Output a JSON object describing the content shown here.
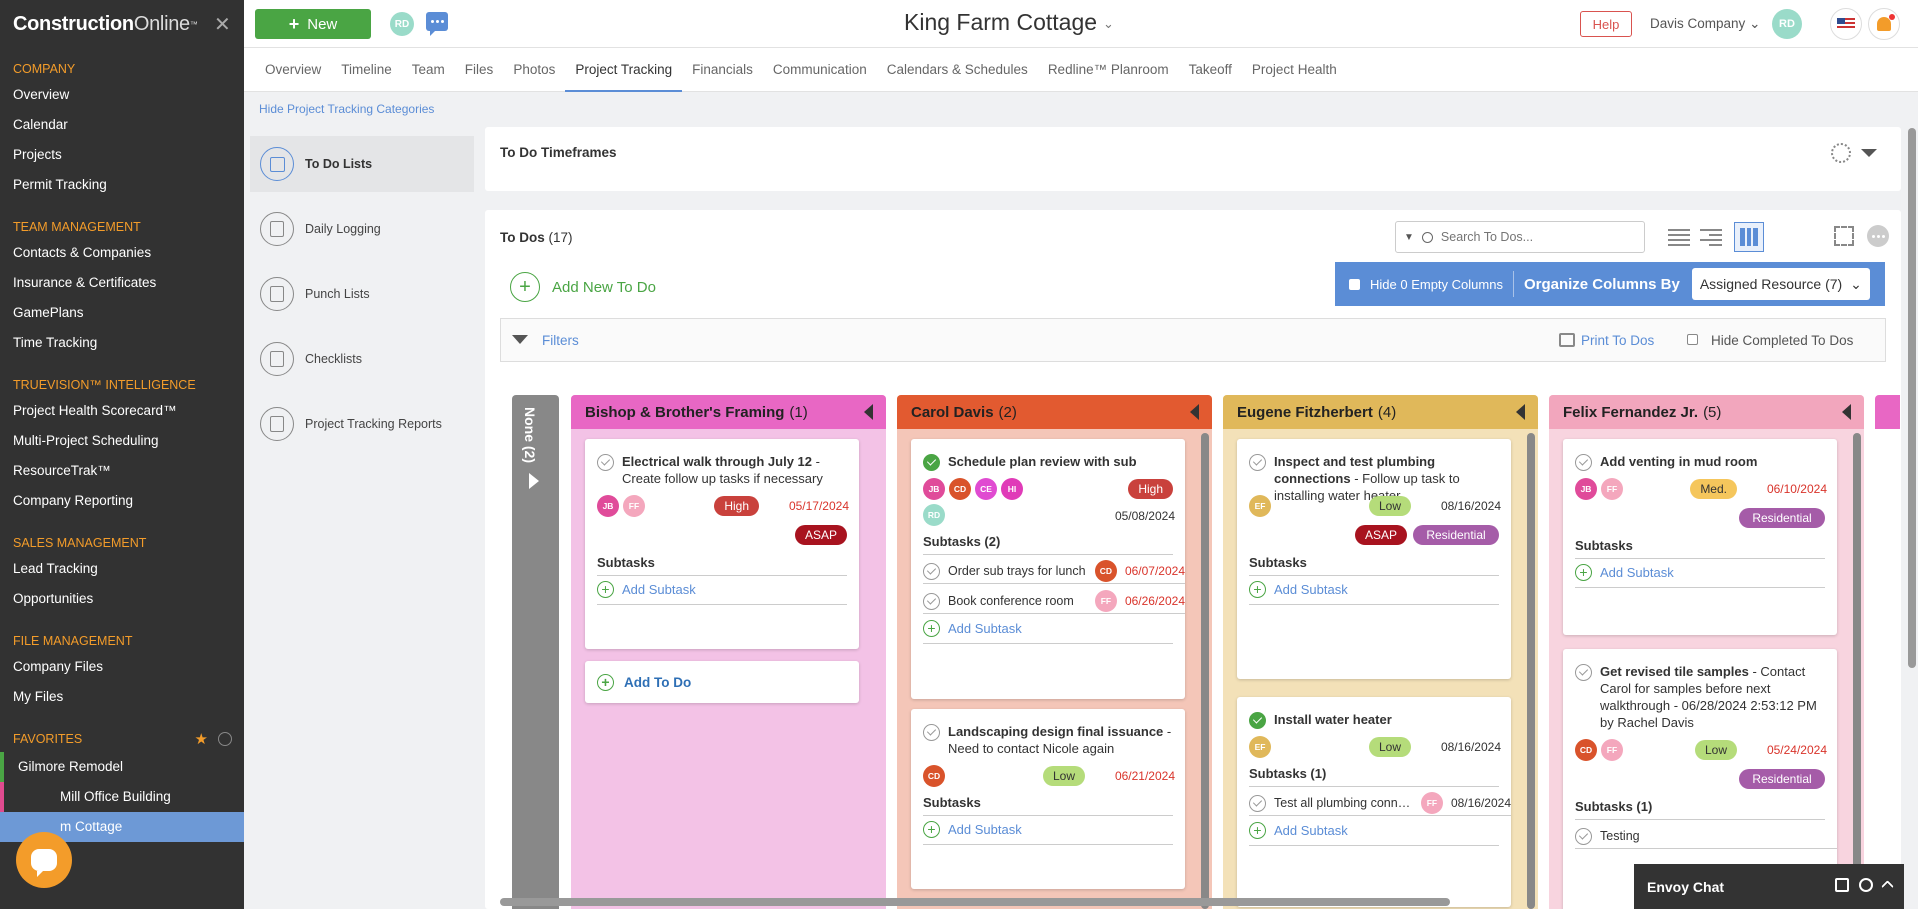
{
  "sidebar": {
    "brand": "Construction",
    "brand_suffix": "Online",
    "brand_tm": "™",
    "close": "✕",
    "sections": [
      {
        "title": "COMPANY",
        "items": [
          "Overview",
          "Calendar",
          "Projects",
          "Permit Tracking"
        ]
      },
      {
        "title": "TEAM MANAGEMENT",
        "items": [
          "Contacts & Companies",
          "Insurance & Certificates",
          "GamePlans",
          "Time Tracking"
        ]
      },
      {
        "title": "TRUEVISION™ INTELLIGENCE",
        "items": [
          "Project Health Scorecard™",
          "Multi-Project Scheduling",
          "ResourceTrak™",
          "Company Reporting"
        ]
      },
      {
        "title": "SALES MANAGEMENT",
        "items": [
          "Lead Tracking",
          "Opportunities"
        ]
      },
      {
        "title": "FILE MANAGEMENT",
        "items": [
          "Company Files",
          "My Files"
        ]
      }
    ],
    "favorites_title": "FAVORITES",
    "favorites": [
      {
        "label": "Gilmore Remodel",
        "color": "#4aa544"
      },
      {
        "label": "Mill Office Building",
        "color": "#e04b8f"
      },
      {
        "label": "m Cottage",
        "color": "#6d99d6"
      }
    ]
  },
  "topbar": {
    "new_label": "New",
    "user_initials": "RD",
    "project_title": "King Farm Cottage",
    "help_label": "Help",
    "company": "Davis Company",
    "avatar_initials": "RD"
  },
  "nav_tabs": [
    "Overview",
    "Timeline",
    "Team",
    "Files",
    "Photos",
    "Project Tracking",
    "Financials",
    "Communication",
    "Calendars & Schedules",
    "Redline™ Planroom",
    "Takeoff",
    "Project Health"
  ],
  "categories": {
    "hide_label": "Hide Project Tracking Categories",
    "items": [
      "To Do Lists",
      "Daily Logging",
      "Punch Lists",
      "Checklists",
      "Project Tracking Reports"
    ]
  },
  "timeframes": {
    "title": "To Do Timeframes"
  },
  "todos": {
    "title": "To Dos",
    "count": "(17)",
    "search_placeholder": "Search To Dos...",
    "add_label": "Add New To Do",
    "hide_empty": "Hide 0 Empty Columns",
    "organize_by": "Organize Columns By",
    "organize_value": "Assigned Resource (7)",
    "filters": "Filters",
    "print": "Print To Dos",
    "hide_completed": "Hide Completed To Dos"
  },
  "board": {
    "none_label": "None (2)",
    "columns": [
      {
        "name": "Bishop & Brother's Framing",
        "count": "(1)",
        "head_color": "#e867c4",
        "body_color": "#f3c2e6",
        "cards": [
          {
            "title": "Electrical walk through July 12",
            "desc": " - Create follow up tasks if necessary",
            "done": false,
            "avatars": [
              {
                "i": "JB",
                "c": "#e04b9a"
              },
              {
                "i": "FF",
                "c": "#f4a7bd"
              }
            ],
            "priority": "High",
            "due": "05/17/2024",
            "tag": "ASAP",
            "subtasks_label": "Subtasks",
            "subtasks": [],
            "add_subtask": "Add Subtask"
          }
        ],
        "add_todo": "Add To Do"
      },
      {
        "name": "Carol Davis",
        "count": "(2)",
        "head_color": "#e25a30",
        "body_color": "#f4c6b8",
        "cards": [
          {
            "title": "Schedule plan review with sub",
            "desc": "",
            "done": true,
            "avatars": [
              {
                "i": "JB",
                "c": "#e04b9a"
              },
              {
                "i": "CD",
                "c": "#d9532b"
              },
              {
                "i": "CE",
                "c": "#e04bd1"
              },
              {
                "i": "HI",
                "c": "#e03bb8"
              },
              {
                "i": "RD",
                "c": "#9adbc9"
              }
            ],
            "priority": "High",
            "due": "05/08/2024",
            "subtasks_label": "Subtasks (2)",
            "subtasks": [
              {
                "text": "Order sub trays for lunch",
                "av": "CD",
                "avc": "#d9532b",
                "due": "06/07/2024"
              },
              {
                "text": "Book conference room",
                "av": "FF",
                "avc": "#f4a7bd",
                "due": "06/26/2024"
              }
            ],
            "add_subtask": "Add Subtask"
          },
          {
            "title": "Landscaping design final issuance",
            "desc": " - Need to contact Nicole again",
            "done": false,
            "avatars": [
              {
                "i": "CD",
                "c": "#d9532b"
              }
            ],
            "priority": "Low",
            "due": "06/21/2024",
            "subtasks_label": "Subtasks",
            "subtasks": [],
            "add_subtask": "Add Subtask"
          }
        ]
      },
      {
        "name": "Eugene Fitzherbert",
        "count": "(4)",
        "head_color": "#e0b85a",
        "body_color": "#f3e1b8",
        "cards": [
          {
            "title": "Inspect and test plumbing connections",
            "desc": " - Follow up task to installing water heater",
            "done": false,
            "avatars": [
              {
                "i": "EF",
                "c": "#e0b85a"
              }
            ],
            "priority": "Low",
            "due": "08/16/2024",
            "tag": "ASAP",
            "tag2": "Residential",
            "subtasks_label": "Subtasks",
            "subtasks": [],
            "add_subtask": "Add Subtask"
          },
          {
            "title": "Install water heater",
            "desc": "",
            "done": true,
            "avatars": [
              {
                "i": "EF",
                "c": "#e0b85a"
              }
            ],
            "priority": "Low",
            "due": "08/16/2024",
            "subtasks_label": "Subtasks (1)",
            "subtasks": [
              {
                "text": "Test all plumbing connections",
                "av": "FF",
                "avc": "#f4a7bd",
                "due": "08/16/2024"
              }
            ],
            "add_subtask": "Add Subtask"
          }
        ]
      },
      {
        "name": "Felix Fernandez Jr.",
        "count": "(5)",
        "head_color": "#f2a6bd",
        "body_color": "#f8d4df",
        "cards": [
          {
            "title": "Add venting in mud room",
            "desc": "",
            "done": false,
            "avatars": [
              {
                "i": "JB",
                "c": "#e04b9a"
              },
              {
                "i": "FF",
                "c": "#f4a7bd"
              }
            ],
            "priority": "Med.",
            "due": "06/10/2024",
            "tag2": "Residential",
            "subtasks_label": "Subtasks",
            "subtasks": [],
            "add_subtask": "Add Subtask"
          },
          {
            "title": "Get revised tile samples",
            "desc": " - Contact Carol for samples before next walkthrough - 06/28/2024 2:53:12 PM by Rachel Davis",
            "done": false,
            "avatars": [
              {
                "i": "CD",
                "c": "#d9532b"
              },
              {
                "i": "FF",
                "c": "#f4a7bd"
              }
            ],
            "priority": "Low",
            "due": "05/24/2024",
            "tag2": "Residential",
            "subtasks_label": "Subtasks (1)",
            "subtasks": [
              {
                "text": "Testing",
                "av": "",
                "avc": "",
                "due": ""
              }
            ],
            "add_subtask": "Add Subtask"
          }
        ]
      }
    ]
  },
  "colors": {
    "green": "#4aa544",
    "blue": "#5b8dd6",
    "high": "#c9413c",
    "asap": "#a8131f",
    "low": "#b5dc7a",
    "med": "#f5c65c",
    "residential": "#a55ca8"
  },
  "envoy": {
    "label": "Envoy Chat"
  }
}
